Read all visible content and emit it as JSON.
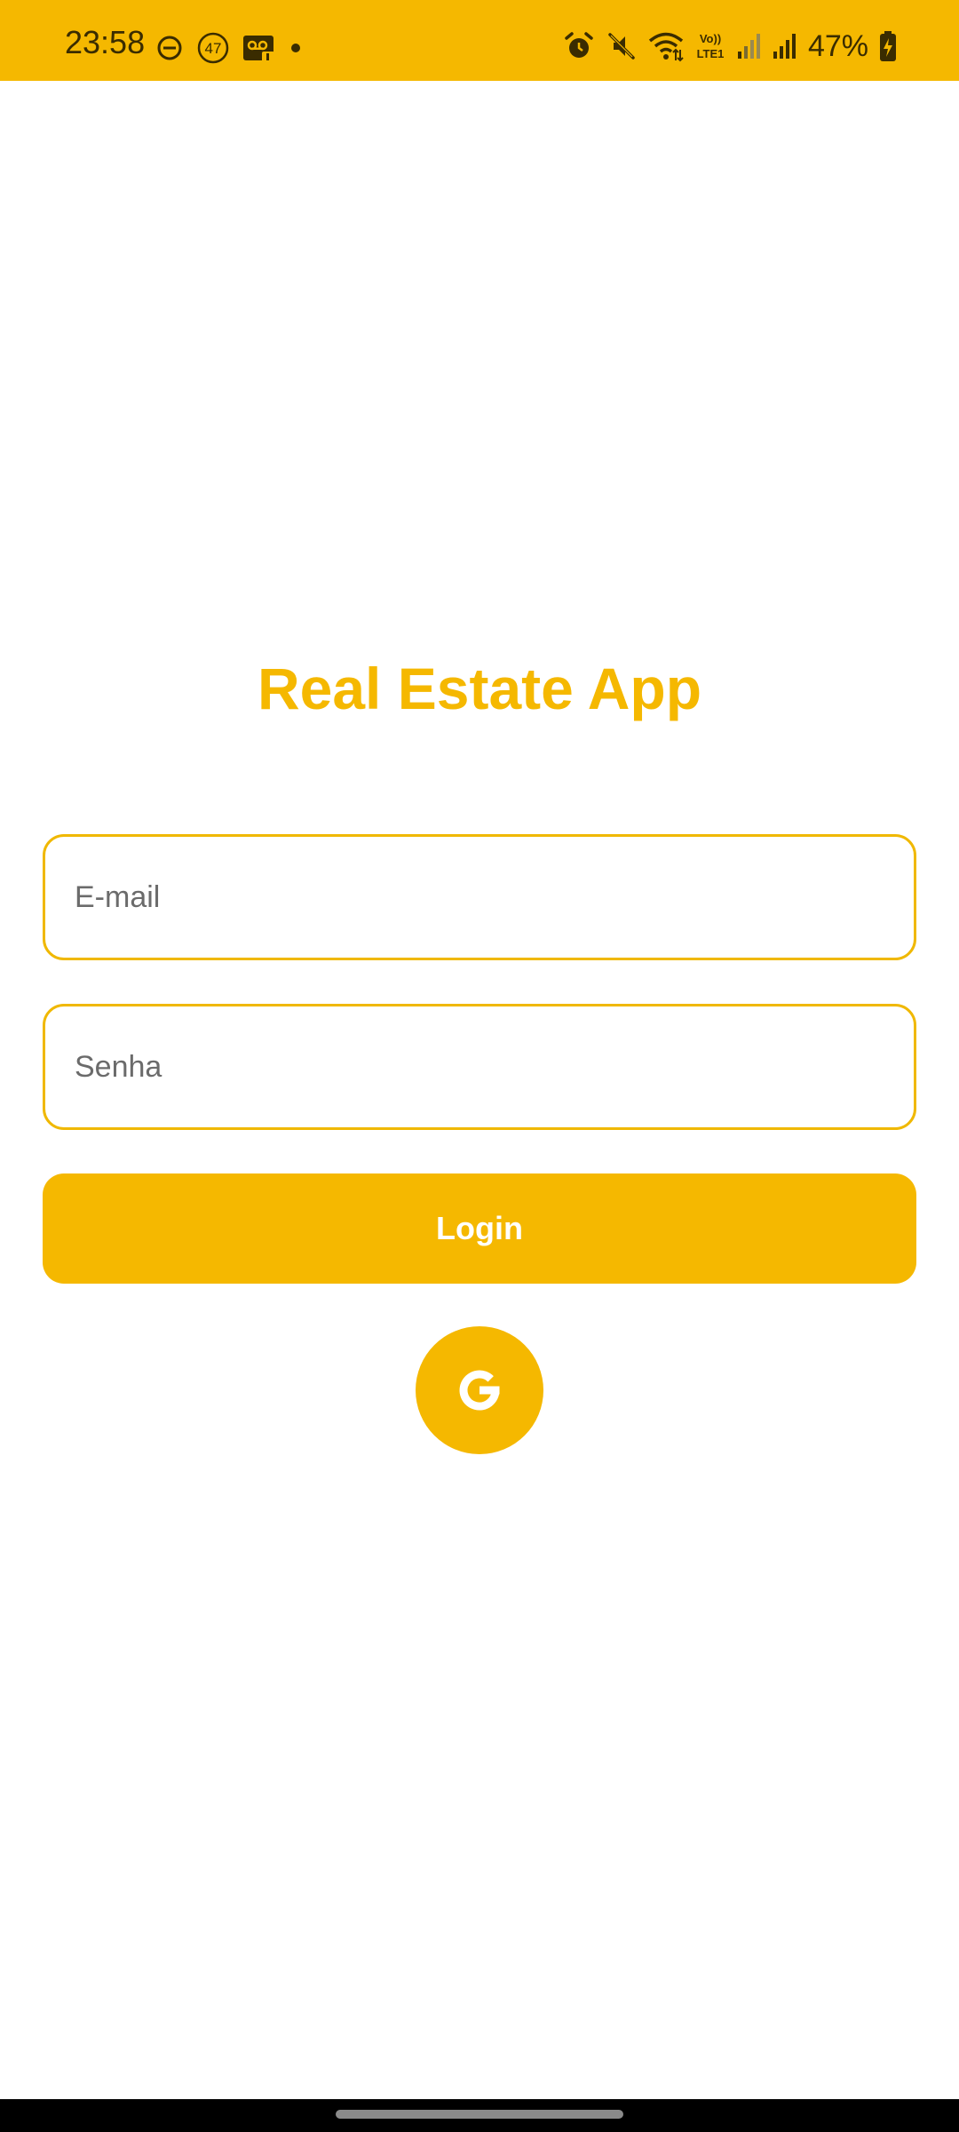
{
  "status_bar": {
    "time": "23:58",
    "left_icons": [
      "do-not-disturb-icon",
      "notification-count-icon",
      "voicemail-icon",
      "dot-icon"
    ],
    "notification_count": "47",
    "right_icons": [
      "alarm-icon",
      "mute-icon",
      "wifi-icon",
      "volte-icon",
      "signal-icon",
      "signal-icon"
    ],
    "volte_label_top": "Vo))",
    "volte_label_bottom": "LTE1",
    "battery_percent": "47%"
  },
  "app": {
    "title": "Real Estate App"
  },
  "form": {
    "email_placeholder": "E-mail",
    "email_value": "",
    "password_placeholder": "Senha",
    "password_value": "",
    "login_label": "Login",
    "google_icon": "google-icon"
  },
  "colors": {
    "accent": "#F5B800",
    "status_text": "#3a2c00",
    "placeholder": "#6b6b6b",
    "background": "#ffffff",
    "nav_bar": "#000000"
  }
}
